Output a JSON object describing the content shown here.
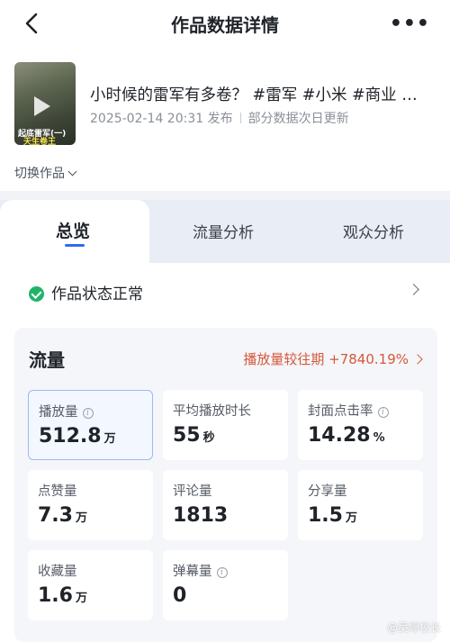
{
  "header": {
    "title": "作品数据详情",
    "more": "•••"
  },
  "video": {
    "thumb_caption_1": "起底雷军(一)",
    "thumb_caption_2": "天生卷王",
    "title": "小时候的雷军有多卷？ #雷军 #小米 #商业 …",
    "publish_time": "2025-02-14 20:31 发布",
    "update_note": "部分数据次日更新",
    "switch_label": "切换作品"
  },
  "tabs": [
    {
      "label": "总览",
      "active": true
    },
    {
      "label": "流量分析",
      "active": false
    },
    {
      "label": "观众分析",
      "active": false
    }
  ],
  "status": {
    "label": "作品状态正常",
    "color": "#22b36b"
  },
  "traffic": {
    "title": "流量",
    "compare": "播放量较往期 +7840.19%",
    "compare_color": "#d4583a",
    "metrics": [
      {
        "label": "播放量",
        "value": "512.8",
        "unit": "万",
        "info": true
      },
      {
        "label": "平均播放时长",
        "value": "55",
        "unit": "秒",
        "info": false
      },
      {
        "label": "封面点击率",
        "value": "14.28",
        "unit": "%",
        "info": true
      },
      {
        "label": "点赞量",
        "value": "7.3",
        "unit": "万",
        "info": false
      },
      {
        "label": "评论量",
        "value": "1813",
        "unit": "",
        "info": false
      },
      {
        "label": "分享量",
        "value": "1.5",
        "unit": "万",
        "info": false
      },
      {
        "label": "收藏量",
        "value": "1.6",
        "unit": "万",
        "info": false
      },
      {
        "label": "弹幕量",
        "value": "0",
        "unit": "",
        "info": true
      }
    ]
  },
  "watermark": "@吴崢校长",
  "accent": "#2d6bf5"
}
